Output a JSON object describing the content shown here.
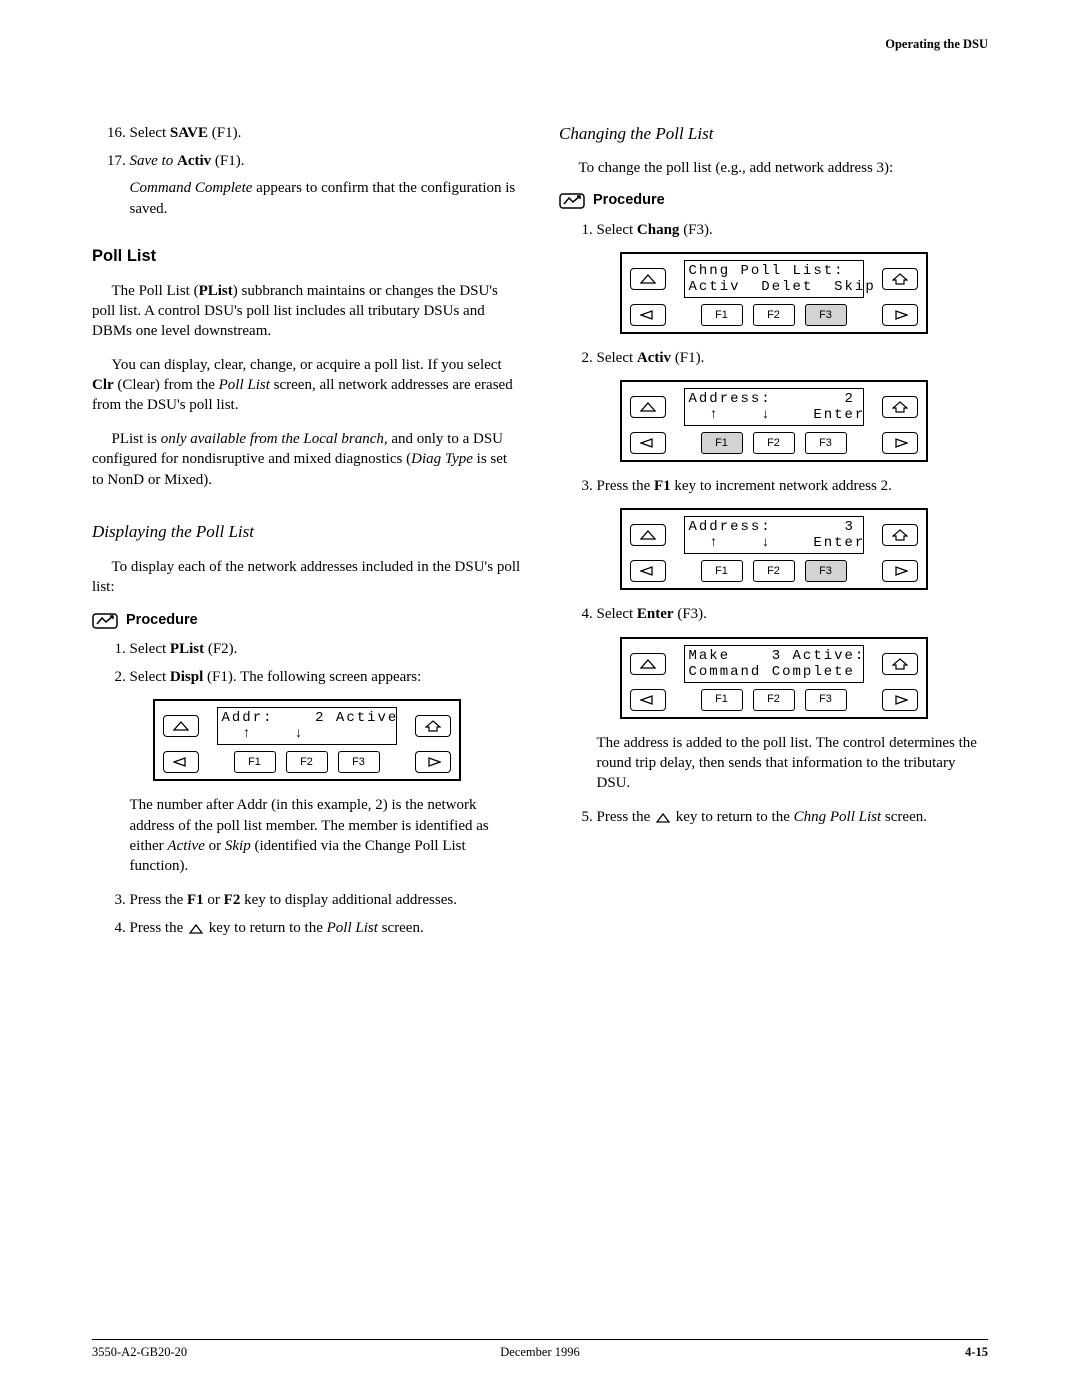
{
  "header": {
    "running": "Operating the DSU"
  },
  "footer": {
    "left": "3550-A2-GB20-20",
    "center": "December 1996",
    "right": "4-15"
  },
  "left": {
    "step16": {
      "n": "16.",
      "pre": "Select ",
      "bold": "SAVE",
      "post": " (F1)."
    },
    "step17": {
      "n": "17.",
      "ital1": "Save to ",
      "bold": "Activ",
      "post": " (F1)."
    },
    "step17_note": {
      "ital": "Command Complete",
      "rest": " appears to confirm that the configuration is saved."
    },
    "poll_list_h": "Poll List",
    "p1a": "The Poll List (",
    "p1b": "PList",
    "p1c": ") subbranch maintains or changes the DSU's poll list. A control DSU's poll list includes all tributary DSUs and DBMs one level downstream.",
    "p2a": "You can display, clear, change, or acquire a poll list. If you select ",
    "p2b": "Clr",
    "p2c": " (Clear) from the ",
    "p2d": "Poll List",
    "p2e": " screen, all network addresses are erased from the DSU's poll list.",
    "p3a": "PList is ",
    "p3b": "only available from the Local branch,",
    "p3c": " and only to a DSU configured for nondisruptive and mixed diagnostics (",
    "p3d": "Diag Type",
    "p3e": " is set to NonD or Mixed).",
    "disp_h": "Displaying the Poll List",
    "disp_intro": "To display each of the network addresses included in the DSU's poll list:",
    "proc_label": "Procedure",
    "d_s1": {
      "pre": "Select ",
      "bold": "PList",
      "post": " (F2)."
    },
    "d_s2": {
      "pre": "Select ",
      "bold": "Displ",
      "post": " (F1). The following screen appears:"
    },
    "lcd1": {
      "line1": "Addr:    2 Active",
      "line2_arrows": true,
      "f": [
        "F1",
        "F2",
        "F3"
      ]
    },
    "d_note": {
      "a": "The number after Addr (in this example, 2) is the network address of the poll list member. The member is identified as either ",
      "b": "Active",
      "c": " or ",
      "d": "Skip",
      "e": " (identified via the Change Poll List function)."
    },
    "d_s3": {
      "a": "Press the ",
      "b": "F1",
      "c": " or ",
      "d": "F2",
      "e": " key to display additional addresses."
    },
    "d_s4": {
      "a": "Press the   ",
      "b": "  key to return to the ",
      "c": "Poll List",
      "d": " screen."
    }
  },
  "right": {
    "chg_h": "Changing the Poll List",
    "chg_intro": "To change the poll list (e.g., add network address 3):",
    "proc_label": "Procedure",
    "c_s1": {
      "pre": "Select ",
      "bold": "Chang",
      "post": " (F3)."
    },
    "lcd1": {
      "line1": "Chng Poll List:",
      "line2": "Activ  Delet  Skip",
      "f": [
        "F1",
        "F2",
        "F3"
      ],
      "active": "F3"
    },
    "c_s2": {
      "pre": "Select ",
      "bold": "Activ",
      "post": " (F1)."
    },
    "lcd2": {
      "line1": "Address:       2",
      "line2_right": "Enter",
      "arrows": true,
      "f": [
        "F1",
        "F2",
        "F3"
      ],
      "active": "F1"
    },
    "c_s3": {
      "a": "Press the ",
      "b": "F1",
      "c": " key to increment network address 2."
    },
    "lcd3": {
      "line1": "Address:       3",
      "line2_right": "Enter",
      "arrows": true,
      "f": [
        "F1",
        "F2",
        "F3"
      ],
      "active": "F3"
    },
    "c_s4": {
      "pre": "Select ",
      "bold": "Enter",
      "post": " (F3)."
    },
    "lcd4": {
      "line1": "Make    3 Active:",
      "line2": "Command Complete",
      "f": [
        "F1",
        "F2",
        "F3"
      ]
    },
    "c_note": "The address is added to the poll list. The control determines the round trip delay, then sends that information to the tributary DSU.",
    "c_s5": {
      "a": "Press the   ",
      "b": "  key to return to the ",
      "c": "Chng Poll List",
      "d": " screen."
    }
  }
}
